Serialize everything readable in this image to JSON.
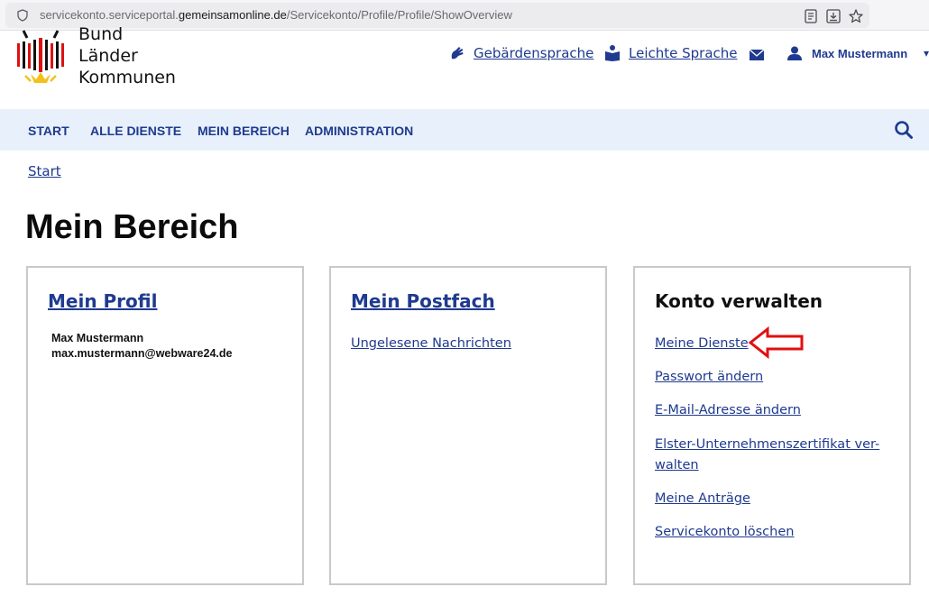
{
  "browser": {
    "url_prefix": "servicekonto.serviceportal.",
    "url_domain": "gemeinsamonline.de",
    "url_path": "/Servicekonto/Profile/Profile/ShowOverview"
  },
  "header": {
    "logo_line1": "Bund",
    "logo_line2": "Länder",
    "logo_line3": "Kommunen",
    "sign_language": "Gebärdensprache",
    "easy_language": "Leichte Sprache",
    "user_name": "Max Mustermann"
  },
  "nav": {
    "items": [
      "START",
      "ALLE DIENSTE",
      "MEIN BEREICH",
      "ADMINISTRATION"
    ]
  },
  "breadcrumb": "Start",
  "page_title": "Mein Bereich",
  "cards": {
    "profile": {
      "title": "Mein Profil",
      "name": "Max Mustermann",
      "email": "max.mustermann@webware24.de"
    },
    "postfach": {
      "title": "Mein Postfach",
      "link": "Ungelesene Nachrichten"
    },
    "konto": {
      "title": "Konto verwalten",
      "links": [
        "Meine Dienste",
        "Passwort ändern",
        "E-Mail-Adresse ändern",
        "Elster-Unternehmenszertifikat ver-",
        "walten",
        "Meine Anträge",
        "Servicekonto löschen"
      ]
    }
  },
  "colors": {
    "link": "#1f3a8f",
    "nav_background": "#e8f1fb",
    "annotation_arrow": "#e01010"
  },
  "icons": [
    "shield-icon",
    "reader-view-icon",
    "download-icon",
    "bookmark-star-icon",
    "sign-language-icon",
    "easy-language-icon",
    "mail-icon",
    "user-icon",
    "search-icon",
    "red-arrow-annotation"
  ]
}
